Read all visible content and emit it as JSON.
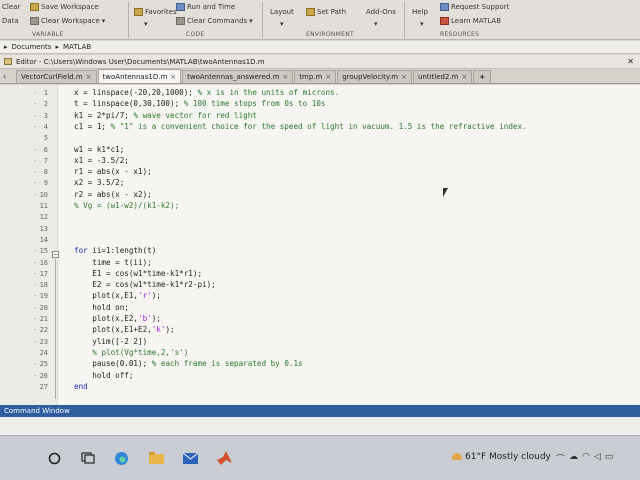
{
  "ribbon": {
    "left_buttons": [
      {
        "label": "Save Workspace",
        "icon": "save-icon"
      },
      {
        "label": "Clear Workspace",
        "icon": "clear-icon"
      }
    ],
    "left_stub_labels": [
      "Clear",
      "Data"
    ],
    "favorites_label": "Favorites",
    "run_and_time_label": "Run and Time",
    "clear_commands_label": "Clear Commands",
    "layout_label": "Layout",
    "set_path_label": "Set Path",
    "addons_label": "Add-Ons",
    "help_label": "Help",
    "request_support_label": "Request Support",
    "learn_matlab_label": "Learn MATLAB",
    "groups": [
      "VARIABLE",
      "CODE",
      "ENVIRONMENT",
      "RESOURCES"
    ]
  },
  "address": {
    "path": [
      "Documents",
      "MATLAB"
    ]
  },
  "editor": {
    "title": "Editor - C:\\Users\\Windows User\\Documents\\MATLAB\\twoAntennas1D.m"
  },
  "tabs": [
    {
      "label": "VectorCurlField.m",
      "active": false
    },
    {
      "label": "twoAntennas1D.m",
      "active": true
    },
    {
      "label": "twoAntennas_answered.m",
      "active": false
    },
    {
      "label": "tmp.m",
      "active": false
    },
    {
      "label": "groupVelocity.m",
      "active": false
    },
    {
      "label": "untitled2.m",
      "active": false
    }
  ],
  "code_lines": [
    {
      "n": "1",
      "text": "x = linspace(-20,20,1000); % x is in the units of microns."
    },
    {
      "n": "2",
      "text": "t = linspace(0,30,100); % 100 time stops from 0s to 10s"
    },
    {
      "n": "3",
      "text": "k1 = 2*pi/7; % wave vector for red light"
    },
    {
      "n": "4",
      "text": "c1 = 1; % \"1\" is a convenient choice for the speed of light in vacuum. 1.5 is the refractive index."
    },
    {
      "n": "5",
      "text": ""
    },
    {
      "n": "6",
      "text": "w1 = k1*c1;"
    },
    {
      "n": "7",
      "text": "x1 = -3.5/2;"
    },
    {
      "n": "8",
      "text": "r1 = abs(x - x1);"
    },
    {
      "n": "9",
      "text": "x2 = 3.5/2;"
    },
    {
      "n": "10",
      "text": "r2 = abs(x - x2);"
    },
    {
      "n": "11",
      "text": "% Vg = (w1-w2)/(k1-k2);"
    },
    {
      "n": "12",
      "text": ""
    },
    {
      "n": "13",
      "text": ""
    },
    {
      "n": "14",
      "text": ""
    },
    {
      "n": "15",
      "text": "for ii=1:length(t)"
    },
    {
      "n": "16",
      "text": "    time = t(ii);"
    },
    {
      "n": "17",
      "text": "    E1 = cos(w1*time-k1*r1);"
    },
    {
      "n": "18",
      "text": "    E2 = cos(w1*time-k1*r2-pi);"
    },
    {
      "n": "19",
      "text": "    plot(x,E1,'r');"
    },
    {
      "n": "20",
      "text": "    hold on;"
    },
    {
      "n": "21",
      "text": "    plot(x,E2,'b');"
    },
    {
      "n": "22",
      "text": "    plot(x,E1+E2,'k');"
    },
    {
      "n": "23",
      "text": "    ylim([-2 2])"
    },
    {
      "n": "24",
      "text": "    % plot(Vg*time,2,'s')"
    },
    {
      "n": "25",
      "text": "    pause(0.01); % each frame is separated by 0.1s"
    },
    {
      "n": "26",
      "text": "    hold off;"
    },
    {
      "n": "27",
      "text": "end"
    }
  ],
  "command_window": {
    "title": "Command Window"
  },
  "taskbar": {
    "weather": "61°F Mostly cloudy"
  }
}
